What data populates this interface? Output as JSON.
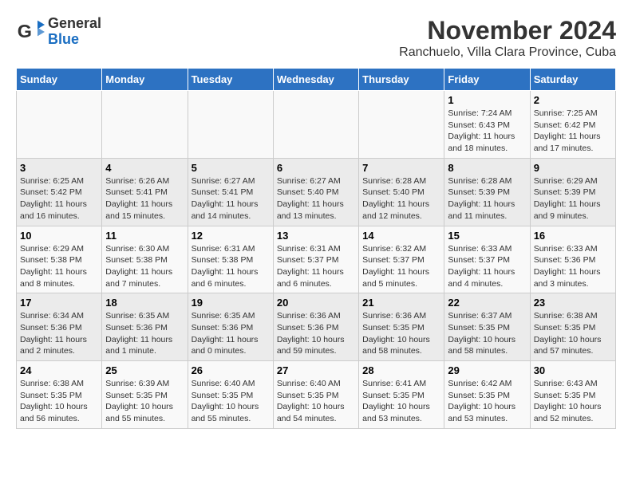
{
  "header": {
    "logo": {
      "line1": "General",
      "line2": "Blue"
    },
    "title": "November 2024",
    "subtitle": "Ranchuelo, Villa Clara Province, Cuba"
  },
  "weekdays": [
    "Sunday",
    "Monday",
    "Tuesday",
    "Wednesday",
    "Thursday",
    "Friday",
    "Saturday"
  ],
  "weeks": [
    [
      {
        "day": "",
        "info": ""
      },
      {
        "day": "",
        "info": ""
      },
      {
        "day": "",
        "info": ""
      },
      {
        "day": "",
        "info": ""
      },
      {
        "day": "",
        "info": ""
      },
      {
        "day": "1",
        "info": "Sunrise: 7:24 AM\nSunset: 6:43 PM\nDaylight: 11 hours and 18 minutes."
      },
      {
        "day": "2",
        "info": "Sunrise: 7:25 AM\nSunset: 6:42 PM\nDaylight: 11 hours and 17 minutes."
      }
    ],
    [
      {
        "day": "3",
        "info": "Sunrise: 6:25 AM\nSunset: 5:42 PM\nDaylight: 11 hours and 16 minutes."
      },
      {
        "day": "4",
        "info": "Sunrise: 6:26 AM\nSunset: 5:41 PM\nDaylight: 11 hours and 15 minutes."
      },
      {
        "day": "5",
        "info": "Sunrise: 6:27 AM\nSunset: 5:41 PM\nDaylight: 11 hours and 14 minutes."
      },
      {
        "day": "6",
        "info": "Sunrise: 6:27 AM\nSunset: 5:40 PM\nDaylight: 11 hours and 13 minutes."
      },
      {
        "day": "7",
        "info": "Sunrise: 6:28 AM\nSunset: 5:40 PM\nDaylight: 11 hours and 12 minutes."
      },
      {
        "day": "8",
        "info": "Sunrise: 6:28 AM\nSunset: 5:39 PM\nDaylight: 11 hours and 11 minutes."
      },
      {
        "day": "9",
        "info": "Sunrise: 6:29 AM\nSunset: 5:39 PM\nDaylight: 11 hours and 9 minutes."
      }
    ],
    [
      {
        "day": "10",
        "info": "Sunrise: 6:29 AM\nSunset: 5:38 PM\nDaylight: 11 hours and 8 minutes."
      },
      {
        "day": "11",
        "info": "Sunrise: 6:30 AM\nSunset: 5:38 PM\nDaylight: 11 hours and 7 minutes."
      },
      {
        "day": "12",
        "info": "Sunrise: 6:31 AM\nSunset: 5:38 PM\nDaylight: 11 hours and 6 minutes."
      },
      {
        "day": "13",
        "info": "Sunrise: 6:31 AM\nSunset: 5:37 PM\nDaylight: 11 hours and 6 minutes."
      },
      {
        "day": "14",
        "info": "Sunrise: 6:32 AM\nSunset: 5:37 PM\nDaylight: 11 hours and 5 minutes."
      },
      {
        "day": "15",
        "info": "Sunrise: 6:33 AM\nSunset: 5:37 PM\nDaylight: 11 hours and 4 minutes."
      },
      {
        "day": "16",
        "info": "Sunrise: 6:33 AM\nSunset: 5:36 PM\nDaylight: 11 hours and 3 minutes."
      }
    ],
    [
      {
        "day": "17",
        "info": "Sunrise: 6:34 AM\nSunset: 5:36 PM\nDaylight: 11 hours and 2 minutes."
      },
      {
        "day": "18",
        "info": "Sunrise: 6:35 AM\nSunset: 5:36 PM\nDaylight: 11 hours and 1 minute."
      },
      {
        "day": "19",
        "info": "Sunrise: 6:35 AM\nSunset: 5:36 PM\nDaylight: 11 hours and 0 minutes."
      },
      {
        "day": "20",
        "info": "Sunrise: 6:36 AM\nSunset: 5:36 PM\nDaylight: 10 hours and 59 minutes."
      },
      {
        "day": "21",
        "info": "Sunrise: 6:36 AM\nSunset: 5:35 PM\nDaylight: 10 hours and 58 minutes."
      },
      {
        "day": "22",
        "info": "Sunrise: 6:37 AM\nSunset: 5:35 PM\nDaylight: 10 hours and 58 minutes."
      },
      {
        "day": "23",
        "info": "Sunrise: 6:38 AM\nSunset: 5:35 PM\nDaylight: 10 hours and 57 minutes."
      }
    ],
    [
      {
        "day": "24",
        "info": "Sunrise: 6:38 AM\nSunset: 5:35 PM\nDaylight: 10 hours and 56 minutes."
      },
      {
        "day": "25",
        "info": "Sunrise: 6:39 AM\nSunset: 5:35 PM\nDaylight: 10 hours and 55 minutes."
      },
      {
        "day": "26",
        "info": "Sunrise: 6:40 AM\nSunset: 5:35 PM\nDaylight: 10 hours and 55 minutes."
      },
      {
        "day": "27",
        "info": "Sunrise: 6:40 AM\nSunset: 5:35 PM\nDaylight: 10 hours and 54 minutes."
      },
      {
        "day": "28",
        "info": "Sunrise: 6:41 AM\nSunset: 5:35 PM\nDaylight: 10 hours and 53 minutes."
      },
      {
        "day": "29",
        "info": "Sunrise: 6:42 AM\nSunset: 5:35 PM\nDaylight: 10 hours and 53 minutes."
      },
      {
        "day": "30",
        "info": "Sunrise: 6:43 AM\nSunset: 5:35 PM\nDaylight: 10 hours and 52 minutes."
      }
    ]
  ]
}
